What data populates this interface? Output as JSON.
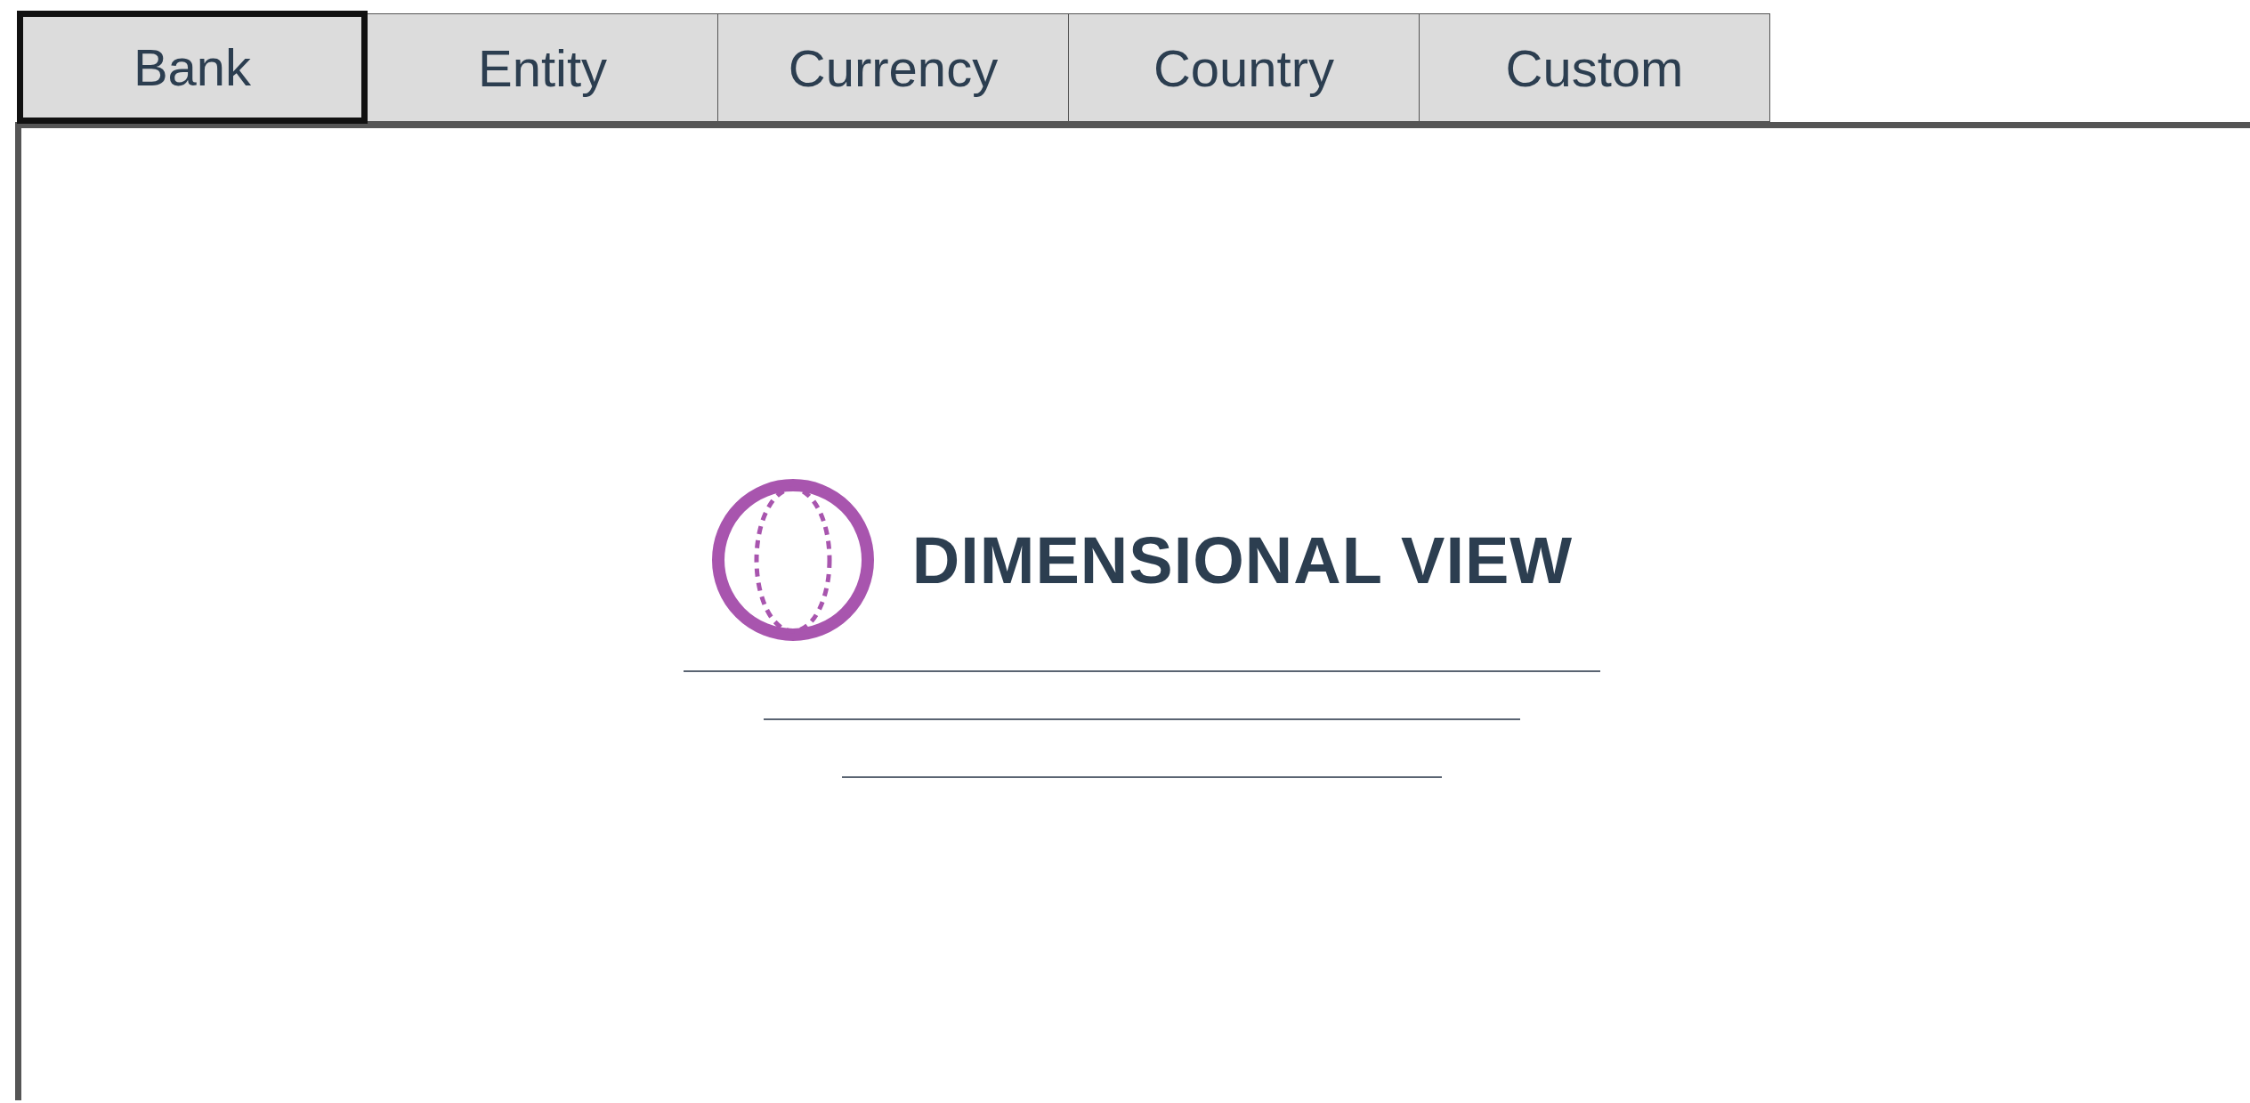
{
  "tabs": [
    {
      "label": "Bank",
      "selected": true
    },
    {
      "label": "Entity",
      "selected": false
    },
    {
      "label": "Currency",
      "selected": false
    },
    {
      "label": "Country",
      "selected": false
    },
    {
      "label": "Custom",
      "selected": false
    }
  ],
  "logo": {
    "title": "DIMENSIONAL VIEW"
  }
}
